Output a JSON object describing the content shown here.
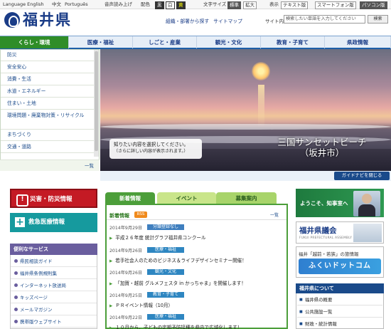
{
  "util": {
    "language": "Language English",
    "chinese": "中文",
    "portuguese": "Português",
    "read_aloud": "音声読み上げ",
    "color_label": "配色",
    "color_black": "黒",
    "color_white": "白",
    "color_yellow": "黄",
    "textsize_label": "文字サイズ",
    "textsize_standard": "標準",
    "textsize_large": "拡大",
    "display_label": "表示",
    "display_text": "テキスト版",
    "display_smartphone": "スマートフォン版",
    "display_pc": "パソコン版"
  },
  "header": {
    "logo_text": "福井県",
    "links": [
      "組織・部署から探す",
      "サイトマップ",
      "サイト内検索"
    ],
    "search_placeholder": "検索したい単語を入力してください",
    "search_button": "検索"
  },
  "nav": [
    "くらし・環境",
    "医療・福祉",
    "しごと・産業",
    "観光・文化",
    "教育・子育て",
    "県政情報"
  ],
  "sidebar": {
    "items": [
      "防災",
      "安全安心",
      "消費・生活",
      "水道・エネルギー",
      "住まい・土地",
      "環境問題・廃棄物対策・リサイクル",
      "まちづくり",
      "交通・道路"
    ],
    "more": "一覧"
  },
  "hero": {
    "tip_line1": "知りたい内容を選択してください。",
    "tip_line2": "（さらに詳しい内容が表示されます。）",
    "caption_line1": "三国サンセットビーチ",
    "caption_line2": "（坂井市）",
    "guide_button": "ガイドナビを閉じる"
  },
  "left": {
    "disaster": "災害・防災情報",
    "rescue": "救急医療情報",
    "services_title": "便利なサービス",
    "services": [
      "県民相談ガイド",
      "福井県条例規則集",
      "インターネット放送局",
      "キッズページ",
      "メールマガジン",
      "携帯版ウェブサイト"
    ]
  },
  "news": {
    "tabs": [
      "新着情報",
      "イベント",
      "募集案内"
    ],
    "label": "新着情報",
    "rss": "RSS",
    "more": "一覧",
    "items": [
      {
        "date": "2014年9月29日",
        "category": "分類登録なし",
        "cat_color": "#3f7fbf",
        "title": "平成２６年度 統計グラフ福井県コンクール"
      },
      {
        "date": "2014年9月26日",
        "category": "医療・福祉",
        "cat_color": "#2e86c1",
        "title": "若手社会人のためのビジネス＆ライフデザインセミナー開催！"
      },
      {
        "date": "2014年9月26日",
        "category": "観光・文化",
        "cat_color": "#2e86c1",
        "title": "「加賀・越前 グルメフェスタ in かっちゃま」を開催します！"
      },
      {
        "date": "2014年9月25日",
        "category": "教育・子育て",
        "cat_color": "#2e86c1",
        "title": "ＰＲイベント情報（10月）"
      },
      {
        "date": "2014年9月22日",
        "category": "医療・福祉",
        "cat_color": "#2e86c1",
        "title": "１０月から、子どもの定期予防接種を県内で広域化します！"
      }
    ]
  },
  "right": {
    "governor": "ようこそ、知事室へ",
    "assembly": "福井県議会",
    "assembly_sub": "FUKUI PREFECTURAL ASSEMBLY",
    "fukui_top": "福井「越前・若狭」の旅情報",
    "fukui_main": "ふくいドットコム",
    "about_title": "福井県について",
    "about_items": [
      "福井県の概要",
      "公共施設一覧",
      "財政・統計情報"
    ]
  }
}
